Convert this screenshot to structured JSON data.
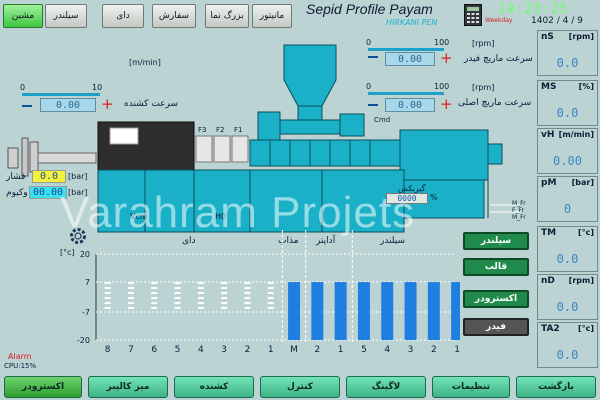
{
  "top_menu": {
    "machine": "مشین",
    "cylinder": "سیلندر",
    "die": "دای",
    "order": "سفارش",
    "zoom": "بزرگ نما",
    "monitor": "مانیتور"
  },
  "header": {
    "title": "Sepid Profile Payam",
    "subtitle": "HIRKANI PEN",
    "clock": "14:23:25",
    "weekday": "Weekday",
    "date": "1402 / 4 / 9"
  },
  "feeder": {
    "unit": "[rpm]",
    "scale_min": "0",
    "scale_max": "100",
    "label": "سرعت ماریچ فیدر",
    "value": "0.00"
  },
  "main_screw": {
    "unit": "[rpm]",
    "scale_min": "0",
    "scale_max": "100",
    "label": "سرعت ماریچ اصلی",
    "value": "0.00"
  },
  "puller": {
    "unit": "[m/min]",
    "scale_min": "0",
    "scale_max": "10",
    "label": "سرعت کشنده",
    "value": "0.00"
  },
  "machine": {
    "fan_labels": [
      "F3",
      "F2",
      "F1"
    ],
    "cmd": "Cmd",
    "gearbox": "گیربکس",
    "gearbox_value": "0000",
    "gearbox_unit": "%",
    "vcm": "Vcm",
    "h0": "H0",
    "motor_labels": [
      "M_Fr",
      "F_Fr",
      "M_Fr"
    ]
  },
  "pressure": {
    "label": "فشار",
    "value": "0.0",
    "unit": "[bar]"
  },
  "vacuum": {
    "label": "وکیوم",
    "value": "00.00",
    "unit": "[bar]"
  },
  "watermark": "Varahram Projets",
  "temp_chart": {
    "unit": "[°c]",
    "y_ticks": [
      "20",
      "7",
      "-7",
      "-20"
    ],
    "group_die": "دای",
    "group_melt": "مذاب",
    "group_adapter": "آداپتر",
    "group_cylinder": "سیلندر",
    "x_labels": [
      "8",
      "7",
      "6",
      "5",
      "4",
      "3",
      "2",
      "1",
      "M",
      "2",
      "1",
      "5",
      "4",
      "3",
      "2",
      "1"
    ]
  },
  "chart_data": {
    "type": "bar",
    "categories": [
      "8",
      "7",
      "6",
      "5",
      "4",
      "3",
      "2",
      "1",
      "M",
      "2",
      "1",
      "5",
      "4",
      "3",
      "2",
      "1"
    ],
    "series": [
      {
        "values": [
          null,
          null,
          null,
          null,
          null,
          null,
          null,
          null,
          0,
          0,
          0,
          0,
          0,
          0,
          0,
          0
        ]
      }
    ],
    "ylim": [
      -20,
      20
    ],
    "ylabel": "[°c]"
  },
  "side_buttons": {
    "cylinder": "سیلندر",
    "mould": "قالب",
    "extruder": "اکسترودر",
    "feeder": "فیدر"
  },
  "status": {
    "alarm": "Alarm",
    "cpu": "CPU:15%"
  },
  "right_panel": [
    {
      "name": "nS",
      "unit": "[rpm]",
      "value": "0.0"
    },
    {
      "name": "MS",
      "unit": "[%]",
      "value": "0.0"
    },
    {
      "name": "vH",
      "unit": "[m/min]",
      "value": "0.00"
    },
    {
      "name": "pM",
      "unit": "[bar]",
      "value": "0"
    },
    {
      "name": "TM",
      "unit": "[°c]",
      "value": "0.0"
    },
    {
      "name": "nD",
      "unit": "[rpm]",
      "value": "0.0"
    },
    {
      "name": "TA2",
      "unit": "[°c]",
      "value": "0.0"
    }
  ],
  "bottom_nav": {
    "extruder": "اکسترودر",
    "calibration": "میز کالیبر",
    "puller": "کشنده",
    "control": "کنترل",
    "logging": "لاگینگ",
    "settings": "تنظیمات",
    "back": "بازگشت"
  },
  "colors": {
    "background": "#bcd3d3",
    "machine_cyan": "#1ab0c8",
    "bar_blue": "#1e7fe0",
    "value_yellow": "#f2f23a",
    "value_cyan": "#39e0ee",
    "clock_green": "#6cff6c"
  }
}
